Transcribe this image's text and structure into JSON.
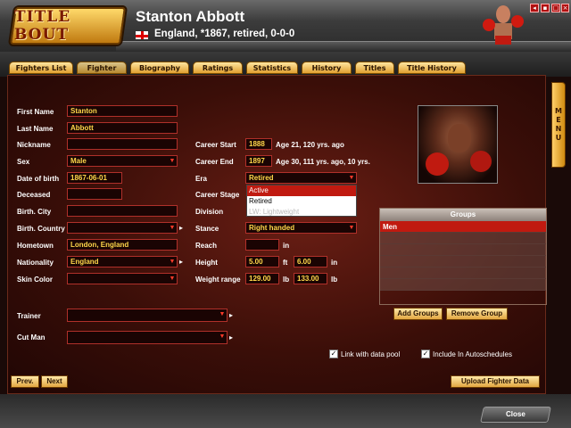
{
  "header": {
    "logo_text": "TITLE BOUT",
    "fighter_name": "Stanton Abbott",
    "fighter_info": "England, *1867, retired, 0-0-0"
  },
  "tabs": [
    "Fighters List",
    "Fighter",
    "Biography",
    "Ratings",
    "Statistics",
    "History",
    "Titles",
    "Title History"
  ],
  "active_tab": "Fighter",
  "menu_label": [
    "M",
    "E",
    "N",
    "U"
  ],
  "form": {
    "first_name": {
      "label": "First Name",
      "value": "Stanton"
    },
    "last_name": {
      "label": "Last Name",
      "value": "Abbott"
    },
    "nickname": {
      "label": "Nickname",
      "value": ""
    },
    "sex": {
      "label": "Sex",
      "value": "Male"
    },
    "dob": {
      "label": "Date of birth",
      "value": "1867-06-01"
    },
    "deceased": {
      "label": "Deceased",
      "value": ""
    },
    "birth_city": {
      "label": "Birth. City",
      "value": ""
    },
    "birth_country": {
      "label": "Birth. Country",
      "value": ""
    },
    "hometown": {
      "label": "Hometown",
      "value": "London, England"
    },
    "nationality": {
      "label": "Nationality",
      "value": "England"
    },
    "skin_color": {
      "label": "Skin Color",
      "value": ""
    },
    "career_start": {
      "label": "Career Start",
      "value": "1888",
      "note": "Age 21, 120 yrs. ago"
    },
    "career_end": {
      "label": "Career End",
      "value": "1897",
      "note": "Age 30, 111 yrs. ago, 10 yrs."
    },
    "era": {
      "label": "Era",
      "value": "Retired"
    },
    "career_stage": {
      "label": "Career Stage"
    },
    "division": {
      "label": "Division"
    },
    "stance": {
      "label": "Stance",
      "value": "Right handed"
    },
    "reach": {
      "label": "Reach",
      "value": "",
      "unit": "in"
    },
    "height": {
      "label": "Height",
      "ft": "5.00",
      "ft_unit": "ft",
      "in": "6.00",
      "in_unit": "in"
    },
    "weight_range": {
      "label": "Weight range",
      "min": "129.00",
      "min_unit": "lb",
      "max": "133.00",
      "max_unit": "lb"
    },
    "trainer": {
      "label": "Trainer",
      "value": ""
    },
    "cut_man": {
      "label": "Cut Man",
      "value": ""
    }
  },
  "era_dropdown": {
    "options": [
      "Active",
      "Retired",
      "LW: Lightweight"
    ],
    "highlighted": "Active"
  },
  "groups": {
    "header": "Groups",
    "items": [
      "Men"
    ],
    "add_label": "Add Groups",
    "remove_label": "Remove Group"
  },
  "checkboxes": {
    "link_pool": {
      "label": "Link with data pool",
      "checked": true
    },
    "autoschedules": {
      "label": "Include In Autoschedules",
      "checked": true
    }
  },
  "buttons": {
    "prev": "Prev.",
    "next": "Next",
    "upload": "Upload Fighter Data",
    "close": "Close"
  },
  "colors": {
    "accent_gold": "#ffd84a",
    "selection_red": "#c01a10",
    "tab_gold": "#e0a030"
  }
}
